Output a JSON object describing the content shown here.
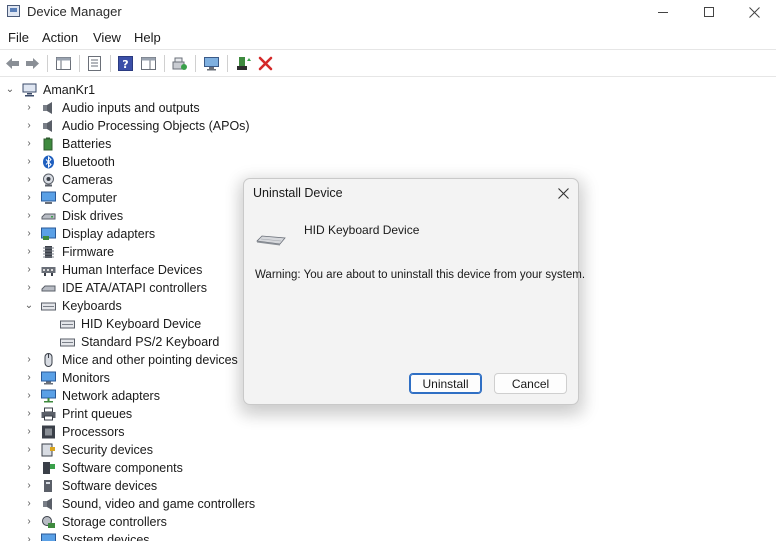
{
  "window": {
    "title": "Device Manager"
  },
  "menu": {
    "file": "File",
    "action": "Action",
    "view": "View",
    "help": "Help"
  },
  "toolbar": {
    "icons": [
      "back-arrow-icon",
      "forward-arrow-icon",
      "show-hide-console-tree-icon",
      "properties-icon",
      "help-icon",
      "action-pane-icon",
      "scan-hardware-icon",
      "monitor-icon",
      "update-driver-icon",
      "uninstall-x-icon"
    ]
  },
  "tree": {
    "root": "AmanKr1",
    "categories": [
      {
        "label": "Audio inputs and outputs",
        "expanded": false
      },
      {
        "label": "Audio Processing Objects (APOs)",
        "expanded": false
      },
      {
        "label": "Batteries",
        "expanded": false
      },
      {
        "label": "Bluetooth",
        "expanded": false
      },
      {
        "label": "Cameras",
        "expanded": false
      },
      {
        "label": "Computer",
        "expanded": false
      },
      {
        "label": "Disk drives",
        "expanded": false
      },
      {
        "label": "Display adapters",
        "expanded": false
      },
      {
        "label": "Firmware",
        "expanded": false
      },
      {
        "label": "Human Interface Devices",
        "expanded": false
      },
      {
        "label": "IDE ATA/ATAPI controllers",
        "expanded": false
      },
      {
        "label": "Keyboards",
        "expanded": true
      },
      {
        "label": "HID Keyboard Device",
        "child": true
      },
      {
        "label": "Standard PS/2 Keyboard",
        "child": true
      },
      {
        "label": "Mice and other pointing devices",
        "expanded": false
      },
      {
        "label": "Monitors",
        "expanded": false
      },
      {
        "label": "Network adapters",
        "expanded": false
      },
      {
        "label": "Print queues",
        "expanded": false
      },
      {
        "label": "Processors",
        "expanded": false
      },
      {
        "label": "Security devices",
        "expanded": false
      },
      {
        "label": "Software components",
        "expanded": false
      },
      {
        "label": "Software devices",
        "expanded": false
      },
      {
        "label": "Sound, video and game controllers",
        "expanded": false
      },
      {
        "label": "Storage controllers",
        "expanded": false
      },
      {
        "label": "System devices",
        "expanded": false
      }
    ]
  },
  "dialog": {
    "title": "Uninstall Device",
    "device_name": "HID Keyboard Device",
    "warning": "Warning: You are about to uninstall this device from your system.",
    "uninstall_label": "Uninstall",
    "cancel_label": "Cancel"
  },
  "colors": {
    "accent": "#2f6fc4",
    "uninstall_red": "#d42a2a",
    "dialog_bg": "#f3f3f3"
  }
}
